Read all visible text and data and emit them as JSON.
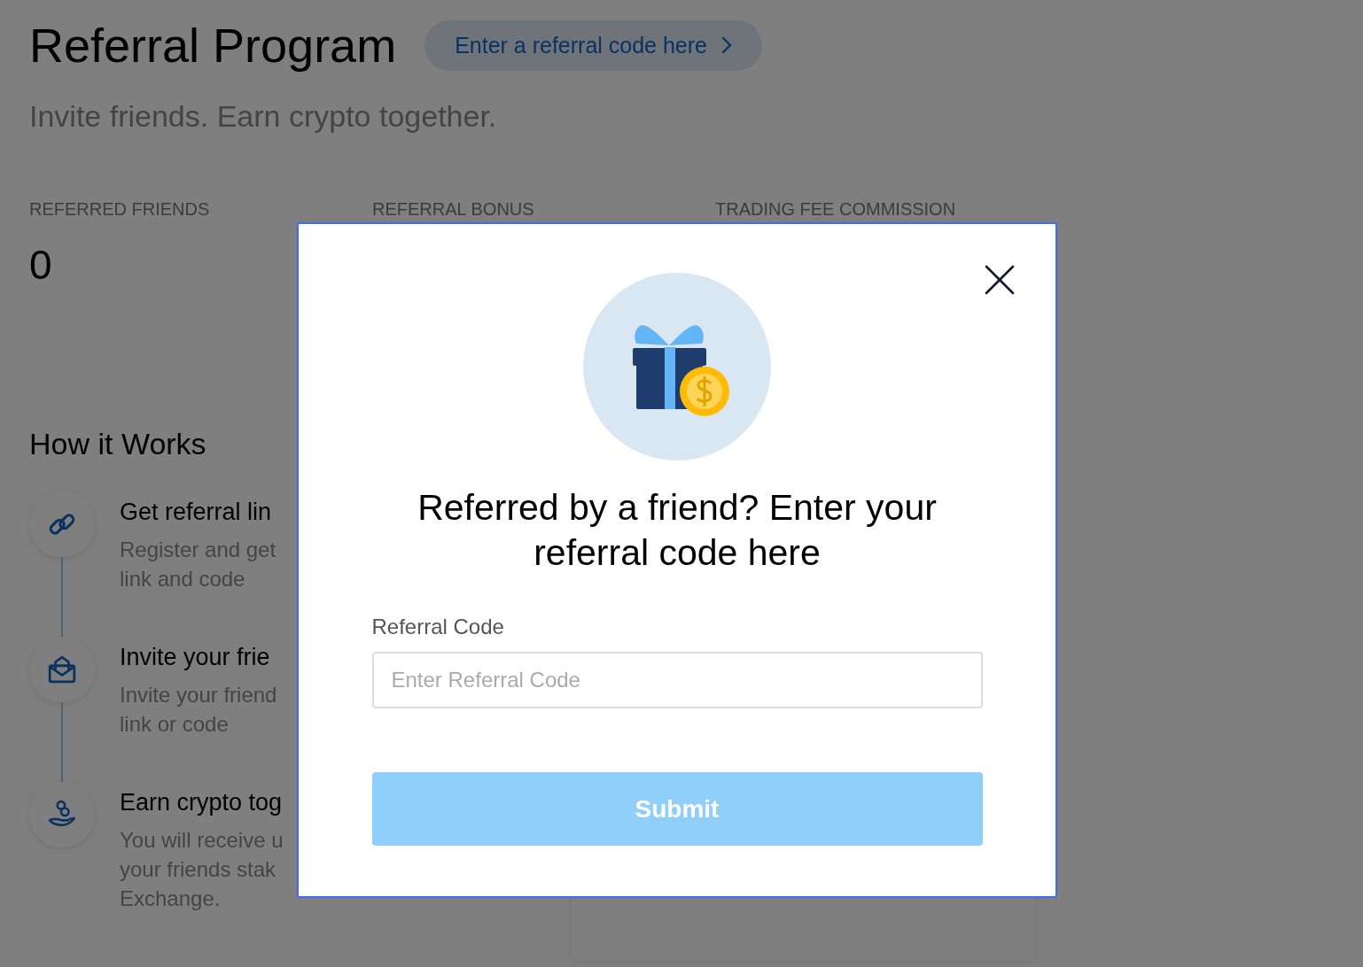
{
  "page": {
    "title": "Referral Program",
    "referral_link": "Enter a referral code here",
    "subtitle": "Invite friends. Earn crypto together."
  },
  "stats": [
    {
      "label": "REFERRED FRIENDS",
      "value": "0"
    },
    {
      "label": "REFERRAL BONUS"
    },
    {
      "label": "TRADING FEE COMMISSION"
    }
  ],
  "how_it_works": {
    "title": "How it Works",
    "steps": [
      {
        "kind": "link",
        "title": "Get referral lin",
        "lines": [
          "Register and get",
          "link and code"
        ]
      },
      {
        "kind": "mail",
        "title": "Invite your frie",
        "lines": [
          "Invite your friend",
          "link or code"
        ]
      },
      {
        "kind": "coins",
        "title": "Earn crypto tog",
        "lines": [
          "You will receive u",
          "your friends stak",
          "Exchange."
        ]
      }
    ]
  },
  "modal": {
    "heading": "Referred by a friend? Enter your referral code here",
    "field_label": "Referral Code",
    "placeholder": "Enter Referral Code",
    "submit": {
      "label": "Submit",
      "disabled": true
    }
  }
}
